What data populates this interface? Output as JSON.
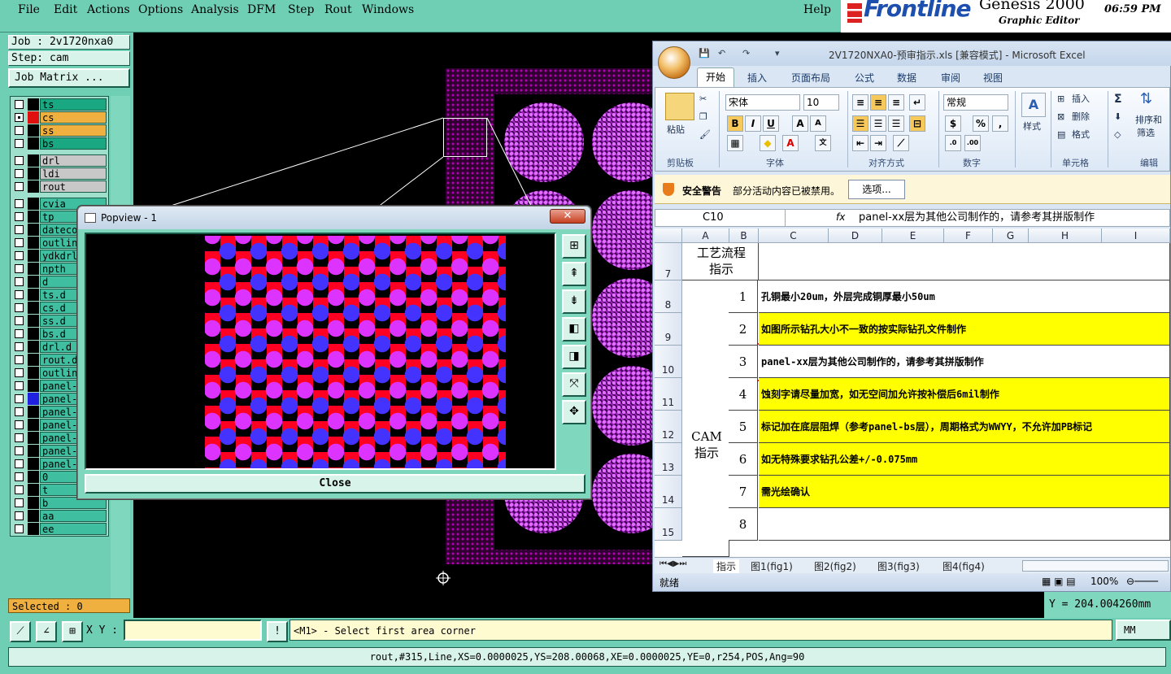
{
  "genesis": {
    "menu": [
      "File",
      "Edit",
      "Actions",
      "Options",
      "Analysis",
      "DFM",
      "Step",
      "Rout",
      "Windows"
    ],
    "help": "Help",
    "brand_logo": "Frontline",
    "product": "Genesis 2000",
    "subtitle": "Graphic Editor",
    "time": "06:59 PM",
    "job": "Job : 2v1720nxa0",
    "step": "Step: cam",
    "job_matrix": "Job Matrix ...",
    "selected": "Selected : 0",
    "layers": [
      {
        "name": "ts",
        "color": "#1aa882",
        "checked": false
      },
      {
        "name": "cs",
        "color": "#f0b040",
        "checked": true,
        "swatch": "#e01010"
      },
      {
        "name": "ss",
        "color": "#f0b040",
        "checked": false
      },
      {
        "name": "bs",
        "color": "#1aa882",
        "checked": false
      },
      {
        "name": "drl",
        "color": "#c8c8c8",
        "checked": false
      },
      {
        "name": "ldi",
        "color": "#c8c8c8",
        "checked": false
      },
      {
        "name": "rout",
        "color": "#c8c8c8",
        "checked": false
      },
      {
        "name": "cvia",
        "color": "#3fbfa0",
        "checked": false
      },
      {
        "name": "tp",
        "color": "#3fbfa0",
        "checked": false
      },
      {
        "name": "datecode",
        "color": "#3fbfa0",
        "checked": false
      },
      {
        "name": "outline",
        "color": "#3fbfa0",
        "checked": false
      },
      {
        "name": "ydkdrl",
        "color": "#3fbfa0",
        "checked": false
      },
      {
        "name": "npth",
        "color": "#3fbfa0",
        "checked": false
      },
      {
        "name": "d",
        "color": "#3fbfa0",
        "checked": false
      },
      {
        "name": "ts.d",
        "color": "#3fbfa0",
        "checked": false
      },
      {
        "name": "cs.d",
        "color": "#3fbfa0",
        "checked": false
      },
      {
        "name": "ss.d",
        "color": "#3fbfa0",
        "checked": false
      },
      {
        "name": "bs.d",
        "color": "#3fbfa0",
        "checked": false
      },
      {
        "name": "drl.d",
        "color": "#3fbfa0",
        "checked": false
      },
      {
        "name": "rout.d",
        "color": "#3fbfa0",
        "checked": false
      },
      {
        "name": "outline",
        "color": "#3fbfa0",
        "checked": false
      },
      {
        "name": "panel-",
        "color": "#3fbfa0",
        "checked": false
      },
      {
        "name": "panel-c",
        "color": "#3fbfa0",
        "checked": false,
        "swatch": "#2020e0"
      },
      {
        "name": "panel-s",
        "color": "#3fbfa0",
        "checked": false
      },
      {
        "name": "panel-b",
        "color": "#3fbfa0",
        "checked": false
      },
      {
        "name": "panel-d",
        "color": "#3fbfa0",
        "checked": false
      },
      {
        "name": "panel-l",
        "color": "#3fbfa0",
        "checked": false
      },
      {
        "name": "panel-r",
        "color": "#3fbfa0",
        "checked": false
      },
      {
        "name": "0",
        "color": "#3fbfa0",
        "checked": false
      },
      {
        "name": "t",
        "color": "#3fbfa0",
        "checked": false
      },
      {
        "name": "b",
        "color": "#3fbfa0",
        "checked": false
      },
      {
        "name": "aa",
        "color": "#3fbfa0",
        "checked": false
      },
      {
        "name": "ee",
        "color": "#3fbfa0",
        "checked": false
      }
    ],
    "coord_y": "Y = 204.004260mm",
    "xy_label": "X Y :",
    "xy_value": "",
    "prompt": "<M1> - Select first area corner",
    "units": "MM",
    "info": "rout,#315,Line,XS=0.0000025,YS=208.00068,XE=0.0000025,YE=0,r254,POS,Ang=90"
  },
  "popview": {
    "title": "Popview - 1",
    "close": "Close",
    "tools": [
      "zoom-in-icon",
      "zoom-page-up-icon",
      "zoom-page-down-icon",
      "pan-left-icon",
      "pan-right-icon",
      "fit-icon",
      "home-icon"
    ]
  },
  "excel": {
    "title": "2V1720NXA0-预审指示.xls [兼容模式] - Microsoft Excel",
    "tabs": [
      "开始",
      "插入",
      "页面布局",
      "公式",
      "数据",
      "审阅",
      "视图"
    ],
    "groups": {
      "clipboard": "剪贴板",
      "font": "字体",
      "align": "对齐方式",
      "number": "数字",
      "cells": "单元格",
      "edit": "编辑"
    },
    "paste": "粘贴",
    "font_name": "宋体",
    "font_size": "10",
    "number_format": "常规",
    "style": "样式",
    "insert": "插入",
    "delete": "删除",
    "format": "格式",
    "sort_filter_1": "排序和",
    "sort_filter_2": "筛选",
    "security_heading": "安全警告",
    "security_msg": "部分活动内容已被禁用。",
    "security_btn": "选项...",
    "namebox": "C10",
    "formula": "panel-xx层为其他公司制作的，请参考其拼版制作",
    "columns": [
      "A",
      "B",
      "C",
      "D",
      "E",
      "F",
      "G",
      "H",
      "I"
    ],
    "header_row": {
      "num": "7",
      "text1": "工艺流程",
      "text2": "指示"
    },
    "section_label_1": "CAM",
    "section_label_2": "指示",
    "rows": [
      {
        "row": "8",
        "n": "1",
        "text": "孔铜最小20um，外层完成铜厚最小50um",
        "hl": false
      },
      {
        "row": "9",
        "n": "2",
        "text": "如图所示钻孔大小不一致的按实际钻孔文件制作",
        "hl": true
      },
      {
        "row": "10",
        "n": "3",
        "text": "panel-xx层为其他公司制作的，请参考其拼版制作",
        "hl": false
      },
      {
        "row": "11",
        "n": "4",
        "text": "蚀刻字请尽量加宽，如无空间加允许按补偿后6mil制作",
        "hl": true
      },
      {
        "row": "12",
        "n": "5",
        "text": "标记加在底层阻焊（参考panel-bs层），周期格式为WWYY，不允许加PB标记",
        "hl": true
      },
      {
        "row": "13",
        "n": "6",
        "text": "如无特殊要求钻孔公差+/-0.075mm",
        "hl": true
      },
      {
        "row": "14",
        "n": "7",
        "text": "需光绘确认",
        "hl": true
      },
      {
        "row": "15",
        "n": "8",
        "text": "",
        "hl": false
      }
    ],
    "sheets": [
      "指示",
      "图1(fig1)",
      "图2(fig2)",
      "图3(fig3)",
      "图4(fig4)"
    ],
    "status": "就绪",
    "zoom": "100%"
  }
}
